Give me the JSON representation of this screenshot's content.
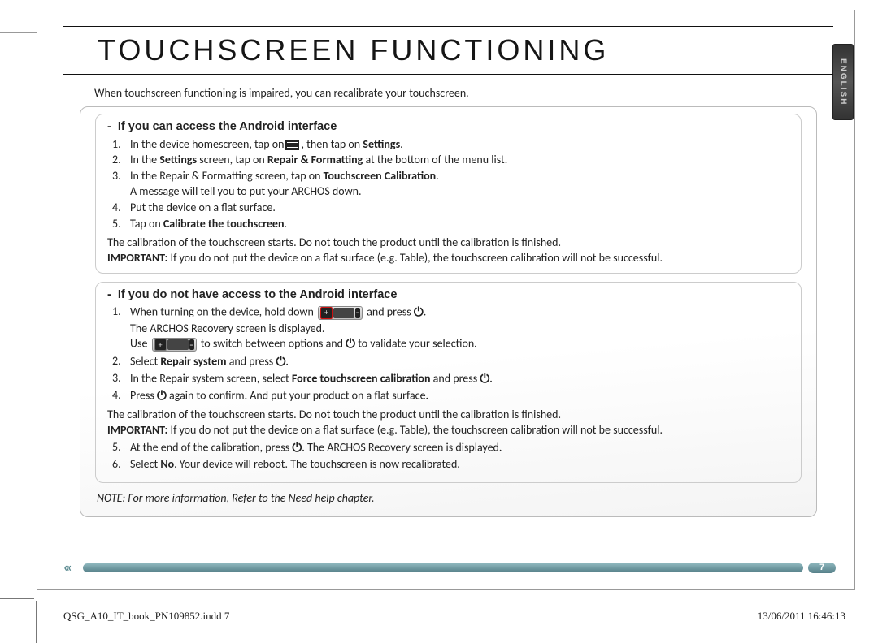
{
  "title": "TOUCHSCREEN FUNCTIONING",
  "side_tab": "ENGLISH",
  "intro": "When touchscreen functioning is impaired, you can recalibrate your touchscreen.",
  "section_a": {
    "heading": "If you can access the Android interface",
    "step1_a": "In the device homescreen, tap on",
    "step1_b": ", then tap on ",
    "step1_c": "Settings",
    "step1_d": ".",
    "step2_a": "In the ",
    "step2_b": "Settings",
    "step2_c": " screen, tap on ",
    "step2_d": "Repair & Formatting",
    "step2_e": " at the bottom of the menu list.",
    "step3_a": "In the Repair & Formatting screen, tap on ",
    "step3_b": "Touchscreen Calibration",
    "step3_c": ".",
    "step3_msg": "A message will tell you to put your ARCHOS down.",
    "step4": "Put the device on a flat surface.",
    "step5_a": "Tap on ",
    "step5_b": "Calibrate the touchscreen",
    "step5_c": ".",
    "after1": "The calibration of the touchscreen starts. Do not touch the product until the calibration is finished.",
    "important": "IMPORTANT:",
    "after2": " If you do not put the device on a flat surface (e.g. Table), the touchscreen calibration will not be successful."
  },
  "section_b": {
    "heading": "If you do not have access to the Android interface",
    "s1_a": "When turning on the device, hold down ",
    "s1_b": " and press ",
    "s1_c": ".",
    "s1_sub1": "The ARCHOS Recovery screen is displayed.",
    "s1_sub2_a": "Use ",
    "s1_sub2_b": " to switch between options and ",
    "s1_sub2_c": " to validate your selection.",
    "s2_a": "Select ",
    "s2_b": "Repair system",
    "s2_c": " and press ",
    "s2_d": ".",
    "s3_a": "In the Repair system screen, select ",
    "s3_b": "Force touchscreen calibration",
    "s3_c": " and press ",
    "s3_d": ".",
    "s4_a": "Press ",
    "s4_b": " again to confirm. And put your product on a flat surface.",
    "mid1": "The calibration of the touchscreen starts. Do not touch the product until the calibration is finished.",
    "important": "IMPORTANT:",
    "mid2": " If you do not put the device on a flat surface (e.g. Table), the touchscreen calibration will not be successful.",
    "s5_a": "At the end of the calibration, press ",
    "s5_b": ". The ARCHOS Recovery screen is displayed.",
    "s6_a": "Select ",
    "s6_b": "No",
    "s6_c": ". Your device will reboot. The touchscreen is now recalibrated."
  },
  "note": "NOTE: For more information, Refer to the Need help chapter.",
  "page_number": "7",
  "footer_left": "QSG_A10_IT_book_PN109852.indd   7",
  "footer_right": "13/06/2011   16:46:13"
}
